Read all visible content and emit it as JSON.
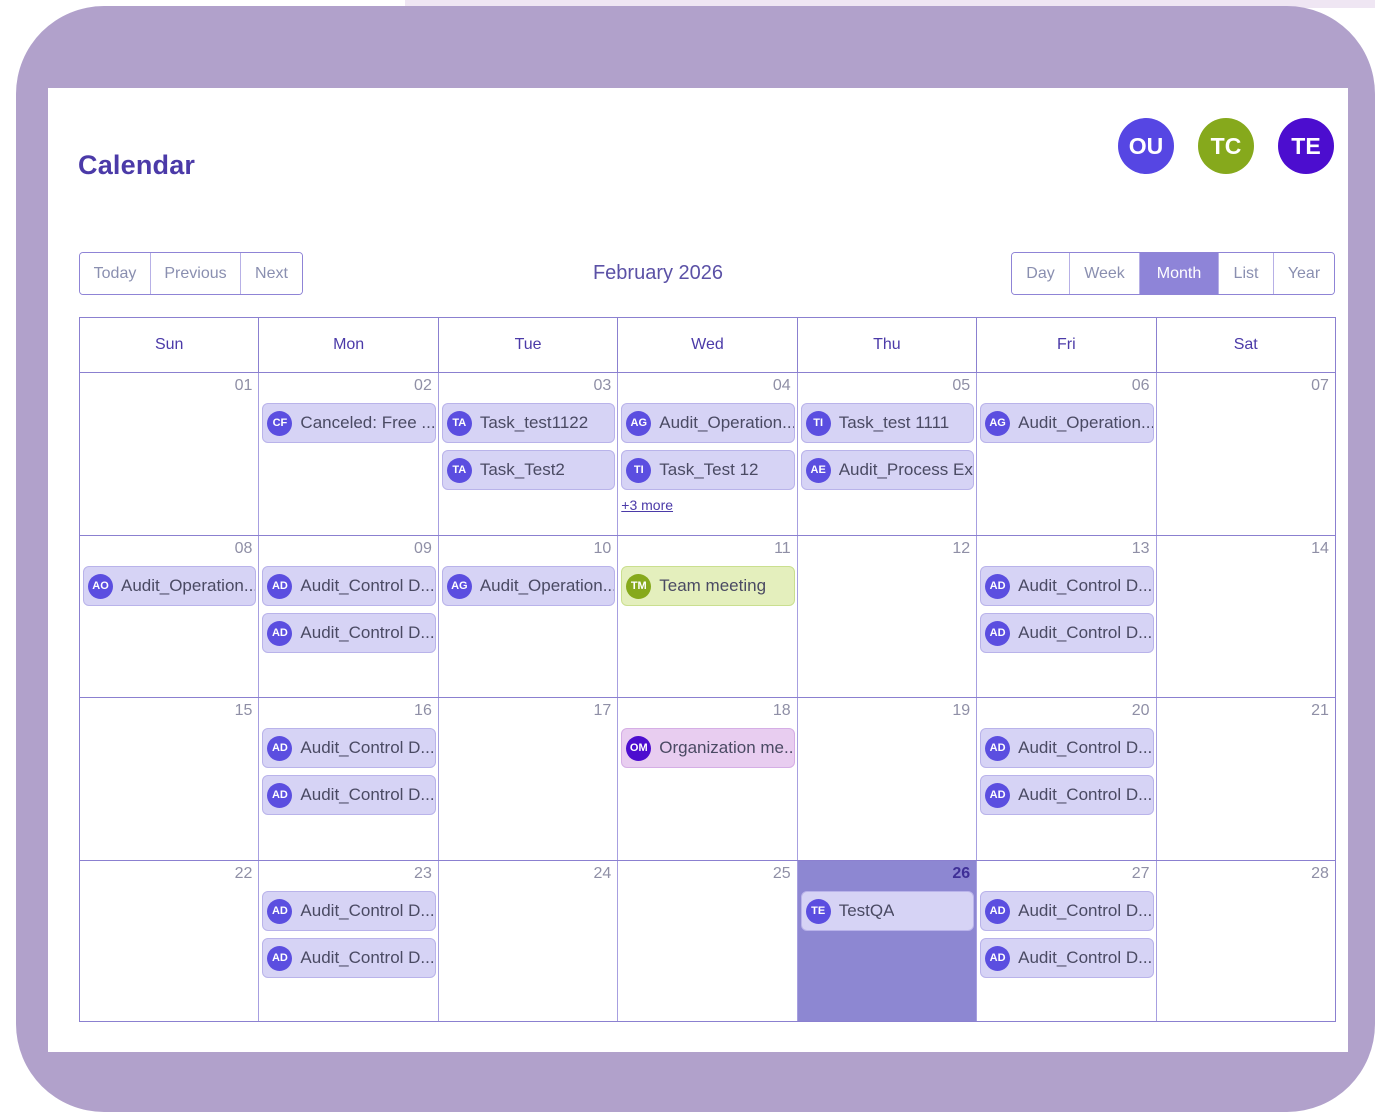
{
  "header": {
    "title": "Calendar"
  },
  "avatars": [
    {
      "initials": "OU",
      "color": "#5646e3"
    },
    {
      "initials": "TC",
      "color": "#86a91c"
    },
    {
      "initials": "TE",
      "color": "#4c0dcf"
    }
  ],
  "toolbar": {
    "nav": [
      "Today",
      "Previous",
      "Next"
    ],
    "title": "February 2026",
    "views": [
      "Day",
      "Week",
      "Month",
      "List",
      "Year"
    ],
    "active_view": "Month"
  },
  "weekdays": [
    "Sun",
    "Mon",
    "Tue",
    "Wed",
    "Thu",
    "Fri",
    "Sat"
  ],
  "today": "26",
  "weeks": [
    [
      {
        "day": "01",
        "events": []
      },
      {
        "day": "02",
        "events": [
          {
            "initials": "CF",
            "title": "Canceled: Free ...",
            "style": "default"
          }
        ]
      },
      {
        "day": "03",
        "events": [
          {
            "initials": "TA",
            "title": "Task_test1122",
            "style": "default"
          },
          {
            "initials": "TA",
            "title": "Task_Test2",
            "style": "default"
          }
        ]
      },
      {
        "day": "04",
        "events": [
          {
            "initials": "AG",
            "title": "Audit_Operation...",
            "style": "default"
          },
          {
            "initials": "TI",
            "title": "Task_Test 12",
            "style": "default"
          }
        ],
        "more": "+3 more"
      },
      {
        "day": "05",
        "events": [
          {
            "initials": "TI",
            "title": "Task_test 1111",
            "style": "default"
          },
          {
            "initials": "AE",
            "title": "Audit_Process Ex...",
            "style": "default"
          }
        ]
      },
      {
        "day": "06",
        "events": [
          {
            "initials": "AG",
            "title": "Audit_Operation...",
            "style": "default"
          }
        ]
      },
      {
        "day": "07",
        "events": []
      }
    ],
    [
      {
        "day": "08",
        "events": [
          {
            "initials": "AO",
            "title": "Audit_Operation...",
            "style": "default"
          }
        ]
      },
      {
        "day": "09",
        "events": [
          {
            "initials": "AD",
            "title": "Audit_Control D...",
            "style": "default"
          },
          {
            "initials": "AD",
            "title": "Audit_Control D...",
            "style": "default"
          }
        ]
      },
      {
        "day": "10",
        "events": [
          {
            "initials": "AG",
            "title": "Audit_Operation...",
            "style": "default"
          }
        ]
      },
      {
        "day": "11",
        "events": [
          {
            "initials": "TM",
            "title": "Team meeting",
            "style": "green"
          }
        ]
      },
      {
        "day": "12",
        "events": []
      },
      {
        "day": "13",
        "events": [
          {
            "initials": "AD",
            "title": "Audit_Control D...",
            "style": "default"
          },
          {
            "initials": "AD",
            "title": "Audit_Control D...",
            "style": "default"
          }
        ]
      },
      {
        "day": "14",
        "events": []
      }
    ],
    [
      {
        "day": "15",
        "events": []
      },
      {
        "day": "16",
        "events": [
          {
            "initials": "AD",
            "title": "Audit_Control D...",
            "style": "default"
          },
          {
            "initials": "AD",
            "title": "Audit_Control D...",
            "style": "default"
          }
        ]
      },
      {
        "day": "17",
        "events": []
      },
      {
        "day": "18",
        "events": [
          {
            "initials": "OM",
            "title": "Organization me...",
            "style": "pink"
          }
        ]
      },
      {
        "day": "19",
        "events": []
      },
      {
        "day": "20",
        "events": [
          {
            "initials": "AD",
            "title": "Audit_Control D...",
            "style": "default"
          },
          {
            "initials": "AD",
            "title": "Audit_Control D...",
            "style": "default"
          }
        ]
      },
      {
        "day": "21",
        "events": []
      }
    ],
    [
      {
        "day": "22",
        "events": []
      },
      {
        "day": "23",
        "events": [
          {
            "initials": "AD",
            "title": "Audit_Control D...",
            "style": "default"
          },
          {
            "initials": "AD",
            "title": "Audit_Control D...",
            "style": "default"
          }
        ]
      },
      {
        "day": "24",
        "events": []
      },
      {
        "day": "25",
        "events": []
      },
      {
        "day": "26",
        "events": [
          {
            "initials": "TE",
            "title": "TestQA",
            "style": "default"
          }
        ]
      },
      {
        "day": "27",
        "events": [
          {
            "initials": "AD",
            "title": "Audit_Control D...",
            "style": "default"
          },
          {
            "initials": "AD",
            "title": "Audit_Control D...",
            "style": "default"
          }
        ]
      },
      {
        "day": "28",
        "events": []
      }
    ]
  ],
  "colors": {
    "frame": "#b1a1cb",
    "accent": "#4b3aa8",
    "event_bg": "#d6d3f5",
    "event_dot": "#5b4ee0",
    "team_dot": "#86a91c",
    "org_dot": "#4c0dcf",
    "today_bg": "#8d87d2"
  }
}
